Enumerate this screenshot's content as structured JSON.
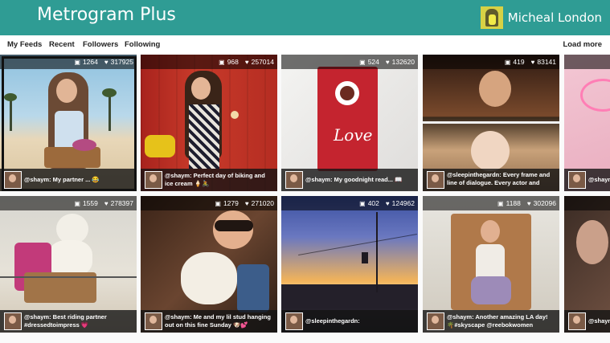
{
  "app": {
    "title": "Metrogram Plus",
    "user_name": "Micheal London"
  },
  "nav": {
    "items": [
      "My Feeds",
      "Recent",
      "Followers",
      "Following"
    ],
    "load_more": "Load more"
  },
  "tiles": [
    {
      "comments": "1264",
      "likes": "317925",
      "caption": "@shaym: My partner ... 😂"
    },
    {
      "comments": "968",
      "likes": "257014",
      "caption": "@shaym: Perfect day of biking and ice cream 🍦🚴"
    },
    {
      "comments": "524",
      "likes": "132620",
      "caption": "@shaym: My goodnight read... 📖"
    },
    {
      "comments": "419",
      "likes": "83141",
      "caption": "@sleepinthegardn: Every frame and line of dialogue. Every actor and every..."
    },
    {
      "comments": "",
      "likes": "",
      "caption": "@shaym"
    },
    {
      "comments": "1559",
      "likes": "278397",
      "caption": "@shaym: Best riding partner #dressedtoimpress 💗"
    },
    {
      "comments": "1279",
      "likes": "271020",
      "caption": "@shaym: Me and my lil stud hanging out on this fine Sunday 🐶💕"
    },
    {
      "comments": "402",
      "likes": "124962",
      "caption": "@sleepinthegardn:"
    },
    {
      "comments": "1188",
      "likes": "302096",
      "caption": "@shaym: Another amazing LA day! 🌴#skyscape @reebokwomen"
    },
    {
      "comments": "",
      "likes": "",
      "caption": "@shaym #WIGS"
    }
  ],
  "icons": {
    "comment": "comment-icon",
    "like": "heart-icon"
  },
  "colors": {
    "accent": "#2f9c94"
  }
}
